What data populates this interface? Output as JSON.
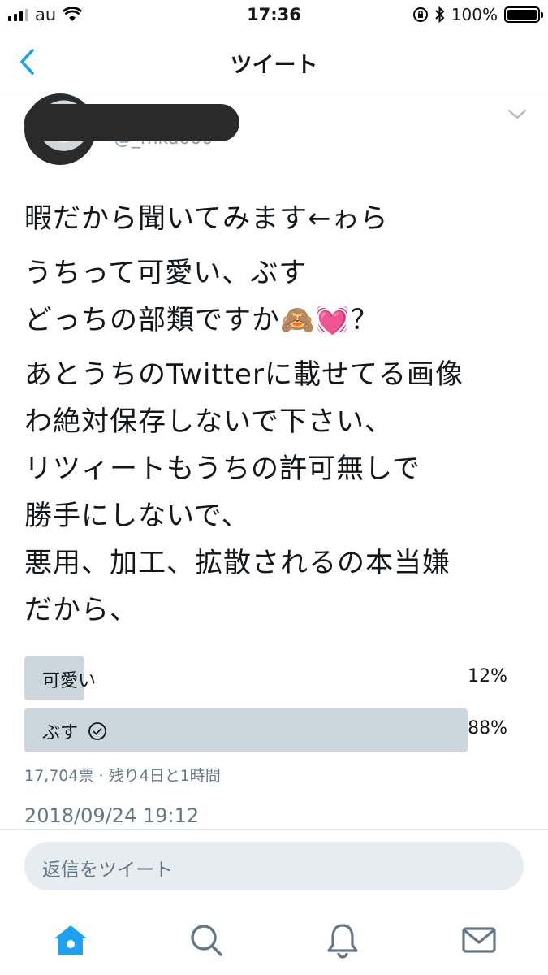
{
  "status_bar": {
    "carrier": "au",
    "time": "17:36",
    "battery": "100%"
  },
  "nav": {
    "title": "ツイート"
  },
  "tweet": {
    "handle": "@_mku000",
    "paragraphs": [
      "暇だから聞いてみます←ゎら",
      "うちって可愛い、ぶす\nどっちの部類ですか🙈💓？",
      "あとうちのTwitterに載せてる画像\nわ絶対保存しないで下さい、\nリツィートもうちの許可無しで\n勝手にしないで、\n悪用、加工、拡散されるの本当嫌\nだから、"
    ],
    "poll": {
      "options": [
        {
          "label": "可愛い",
          "percent": "12%",
          "fraction": 0.12,
          "selected": false
        },
        {
          "label": "ぶす",
          "percent": "88%",
          "fraction": 0.88,
          "selected": true
        }
      ],
      "meta": "17,704票 · 残り4日と1時間"
    },
    "timestamp": "2018/09/24 19:12"
  },
  "reply": {
    "placeholder": "返信をツイート"
  },
  "tabs": [
    {
      "name": "home",
      "icon": "home-icon",
      "active": true
    },
    {
      "name": "search",
      "icon": "search-icon",
      "active": false
    },
    {
      "name": "notifications",
      "icon": "bell-icon",
      "active": false
    },
    {
      "name": "messages",
      "icon": "mail-icon",
      "active": false
    }
  ],
  "colors": {
    "accent": "#1da1f2",
    "poll_bar": "#ccd6dd",
    "muted": "#657786"
  }
}
